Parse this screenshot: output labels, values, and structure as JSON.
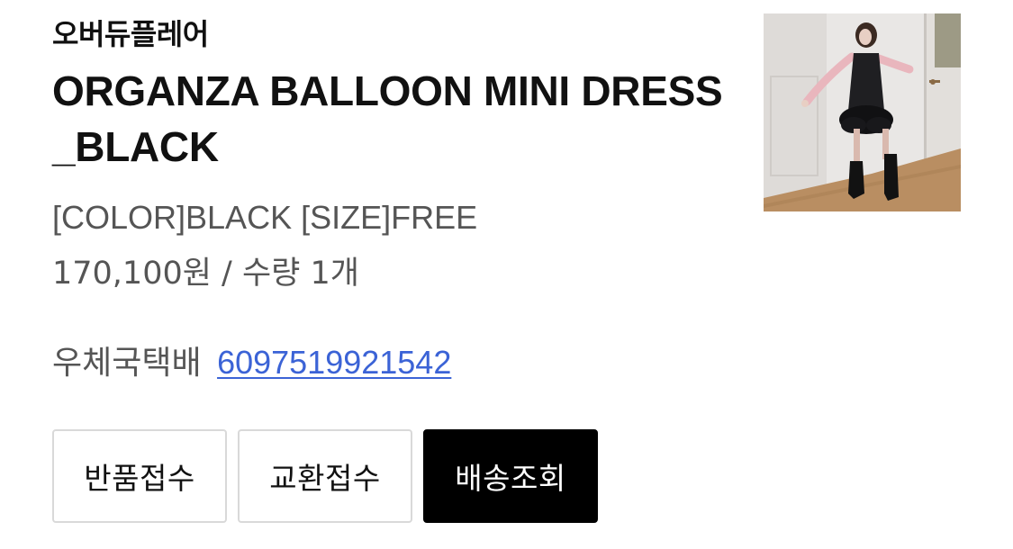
{
  "order_item": {
    "brand": "오버듀플레어",
    "product_name_line1": "ORGANZA BALLOON MINI DRESS",
    "product_name_line2": "_BLACK",
    "option_text": "[COLOR]BLACK [SIZE]FREE",
    "price_qty_text": "170,100원 / 수량 1개",
    "thumbnail_alt": "ORGANZA BALLOON MINI DRESS _BLACK",
    "courier": "우체국택배",
    "tracking_number": "6097519921542"
  },
  "actions": {
    "return_label": "반품접수",
    "exchange_label": "교환접수",
    "delivery_label": "배송조회"
  },
  "colors": {
    "link": "#3b63d6",
    "primary_button": "#000000",
    "button_border": "#d9d9d9",
    "secondary_text": "#555555"
  }
}
